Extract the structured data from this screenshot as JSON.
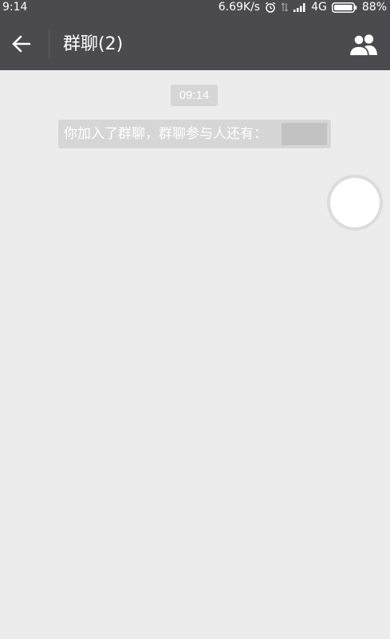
{
  "status_bar": {
    "time": "9:14",
    "network_speed": "6.69K/s",
    "network_type": "4G",
    "battery_percent": "88%",
    "icons": [
      "alarm-icon",
      "data-transfer-icon",
      "signal-icon",
      "battery-icon"
    ]
  },
  "header": {
    "title": "群聊(2)",
    "back_icon": "back-arrow-icon",
    "members_icon": "group-members-icon"
  },
  "chat": {
    "timestamp": "09:14",
    "system_message": "你加入了群聊，群聊参与人还有："
  },
  "colors": {
    "header_bg": "#4b4b4f",
    "chat_bg": "#ececec",
    "chip_bg": "#d6d6d6",
    "redacted": "#c2c2c2"
  }
}
